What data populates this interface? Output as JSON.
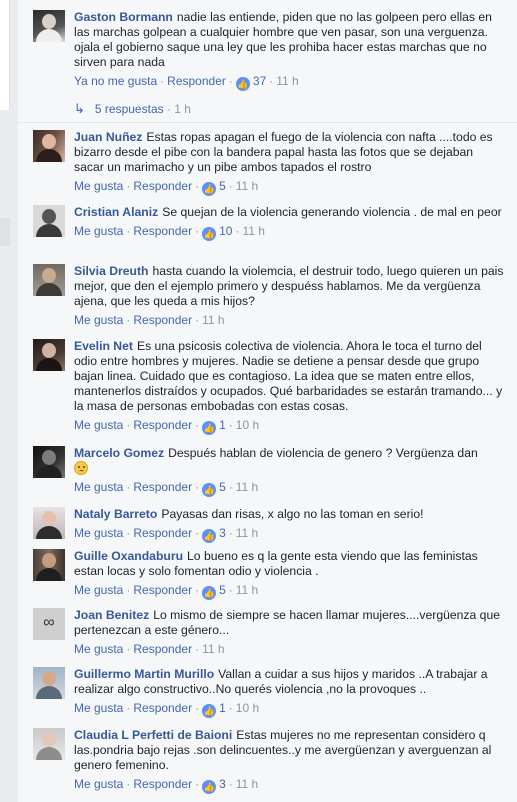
{
  "comments": [
    {
      "name": "Gaston Bormann",
      "text": "nadie las entiende, piden que no las golpeen pero ellas en las marchas golpean a cualquier hombre que ven pasar, son una verguenza. ojala el gobierno saque una ley que les prohiba hacer estas marchas que no sirven para nada",
      "like": "Ya no me gusta",
      "reply": "Responder",
      "reactions": "37",
      "time": "11 h",
      "replies_label": "5 respuestas",
      "replies_time": "1 h"
    },
    {
      "name": "Juan Nuñez",
      "text": "Estas ropas apagan el fuego de la violencia con nafta ....todo es bizarro desde el pibe con la bandera papal hasta las fotos que se dejaban sacar un marimacho y un pibe ambos tapados el rostro",
      "like": "Me gusta",
      "reply": "Responder",
      "reactions": "5",
      "time": "11 h"
    },
    {
      "name": "Cristian Alaniz",
      "text": "Se quejan de la violencia generando violencia . de mal en peor",
      "like": "Me gusta",
      "reply": "Responder",
      "reactions": "10",
      "time": "11 h"
    },
    {
      "name": "Silvia Dreuth",
      "text": "hasta cuando la violemcia, el destruir todo, luego quieren un pais mejor, que den el ejemplo primero y despuéss hablamos. Me da vergüenza ajena, que les queda a mis hijos?",
      "like": "Me gusta",
      "reply": "Responder",
      "time": "11 h"
    },
    {
      "name": "Evelin Net",
      "text": "Es una psicosis colectiva de violencia. Ahora le toca el turno del odio entre hombres y mujeres. Nadie se detiene a pensar desde que grupo bajan linea. Cuidado que es contagioso. La idea que se maten entre ellos, mantenerlos distraídos y ocupados. Qué barbaridades se estarán tramando... y la masa de personas embobadas con estas cosas.",
      "like": "Me gusta",
      "reply": "Responder",
      "reactions": "1",
      "time": "10 h"
    },
    {
      "name": "Marcelo Gomez",
      "text": "Después hablan de violencia de genero ? Vergüenza dan",
      "emoji": "sad-face",
      "like": "Me gusta",
      "reply": "Responder",
      "reactions": "5",
      "time": "11 h"
    },
    {
      "name": "Nataly Barreto",
      "text": "Payasas dan risas, x algo no las toman en serio!",
      "like": "Me gusta",
      "reply": "Responder",
      "reactions": "3",
      "time": "11 h"
    },
    {
      "name": "Guille Oxandaburu",
      "text": "Lo bueno es q la gente esta viendo que las feministas estan locas y solo fomentan odio y violencia .",
      "like": "Me gusta",
      "reply": "Responder",
      "reactions": "5",
      "time": "11 h"
    },
    {
      "name": "Joan Benitez",
      "text": "Lo mismo de siempre se hacen llamar mujeres....vergüenza que pertenezcan a este género...",
      "like": "Me gusta",
      "reply": "Responder",
      "time": "11 h"
    },
    {
      "name": "Guillermo Martin Murillo",
      "text": "Vallan a cuidar a sus hijos y maridos ..A trabajar a realizar algo constructivo..No querés violencia ,no la provoques ..",
      "like": "Me gusta",
      "reply": "Responder",
      "reactions": "1",
      "time": "10 h"
    },
    {
      "name": "Claudia L Perfetti de Baioni",
      "text": "Estas mujeres no me representan considero q las.pondria bajo rejas .son delincuentes..y me avergüenzan y averguenzan al genero femenino.",
      "like": "Me gusta",
      "reply": "Responder",
      "reactions": "3",
      "time": "11 h"
    }
  ],
  "colors": {
    "name": "#365899",
    "link": "#4267b2",
    "meta": "#90949c",
    "like_icon": "#5890ff"
  },
  "icons": {
    "reaction": "like-thumb-icon",
    "replies": "reply-arrow-icon"
  }
}
